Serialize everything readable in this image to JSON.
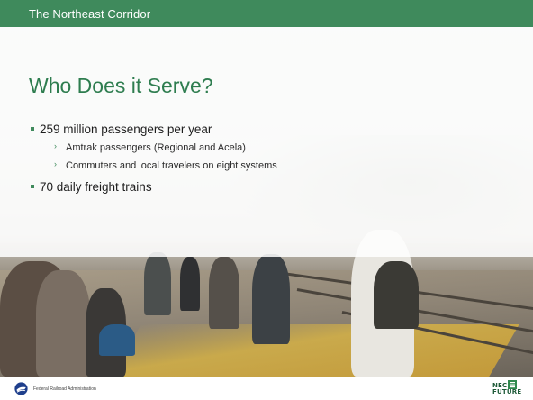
{
  "header": {
    "section_title": "The Northeast Corridor"
  },
  "slide": {
    "title": "Who Does it Serve?"
  },
  "bullets": [
    {
      "text": "259 million passengers per year",
      "sub": [
        "Amtrak passengers (Regional and Acela)",
        "Commuters and local travelers on eight systems"
      ]
    },
    {
      "text": "70 daily freight trains",
      "sub": []
    }
  ],
  "footer": {
    "agency": "Federal Railroad Administration",
    "agency_logo_icon": "fra-logo-icon",
    "program_logo": {
      "line1": "NEC",
      "line2": "FUTURE"
    }
  },
  "colors": {
    "accent_green": "#3f8a5c",
    "title_green": "#2e7d4f"
  },
  "background_image": "train-platform-commuters-photo"
}
